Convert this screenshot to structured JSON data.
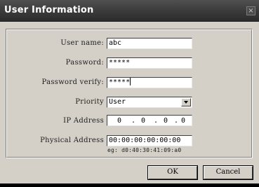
{
  "window": {
    "title": "User Information",
    "close_glyph": "×"
  },
  "form": {
    "user_name": {
      "label": "User name:",
      "value": "abc"
    },
    "password": {
      "label": "Password:",
      "value": "*****"
    },
    "password_verify": {
      "label": "Password verify:",
      "value": "*****"
    },
    "priority": {
      "label": "Priority",
      "selected": "User"
    },
    "ip_address": {
      "label": "IP Address",
      "octets": [
        "0",
        "0",
        "0",
        "0"
      ],
      "separator": "."
    },
    "physical_address": {
      "label": "Physical Address",
      "value": "00:00:00:00:00:00",
      "hint": "eg: d0:40:30:41:09:a0"
    }
  },
  "buttons": {
    "ok_label": "OK",
    "cancel_label": "Cancel"
  }
}
